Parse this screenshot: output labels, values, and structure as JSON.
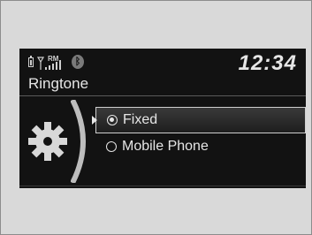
{
  "status": {
    "signal_label": "RM",
    "time": "12:34"
  },
  "menu": {
    "title": "Ringtone"
  },
  "options": [
    {
      "label": "Fixed",
      "selected": true
    },
    {
      "label": "Mobile Phone",
      "selected": false
    }
  ],
  "icons": {
    "battery": "battery-icon",
    "signal": "signal-strength-icon",
    "bluetooth": "bluetooth-icon",
    "settings": "gear-icon",
    "cursor": "selection-arrow-icon"
  },
  "colors": {
    "screen_bg": "#121212",
    "text": "#e6e6e6",
    "highlight_border": "#cfcfcf"
  }
}
